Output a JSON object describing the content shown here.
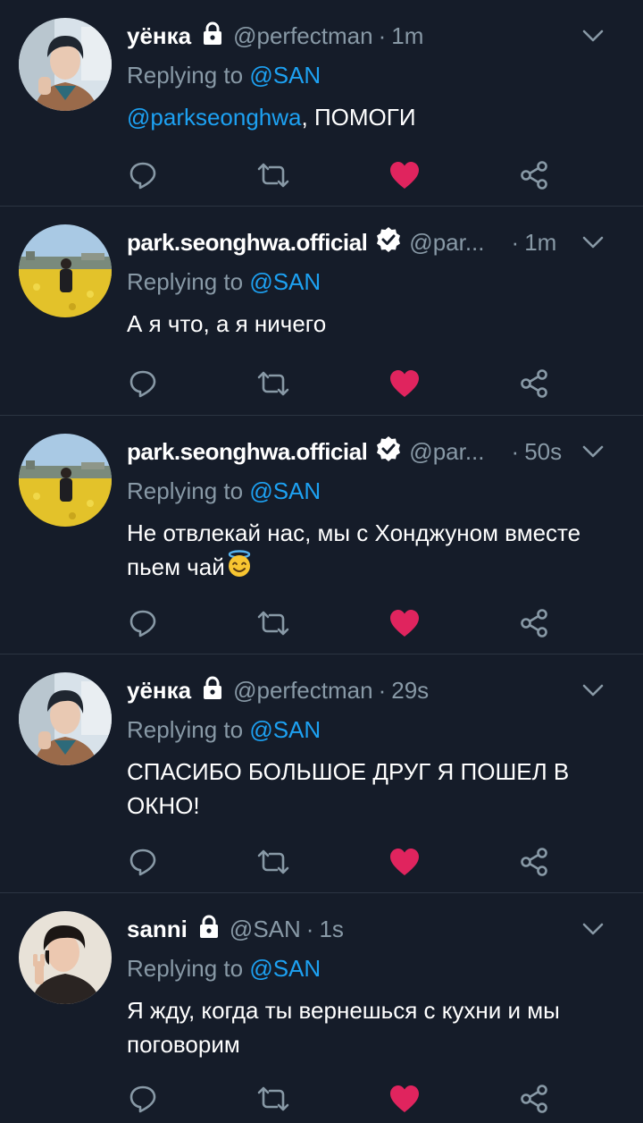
{
  "tweets": [
    {
      "name": "уёнка",
      "handle": "@perfectman",
      "time": "1m",
      "replying_prefix": "Replying to ",
      "replying_to": "@SAN",
      "mention": "@parkseonghwa",
      "text": ", ПОМОГИ",
      "liked": true,
      "protected": true
    },
    {
      "name": "park.seonghwa.official",
      "handle": "@par...",
      "time": "1m",
      "replying_prefix": "Replying to ",
      "replying_to": "@SAN",
      "text": "А я что, а я ничего",
      "liked": true,
      "verified": true
    },
    {
      "name": "park.seonghwa.official",
      "handle": "@par...",
      "time": "50s",
      "replying_prefix": "Replying to ",
      "replying_to": "@SAN",
      "text": "Не отвлекай нас, мы с Хонджуном вместе пьем чай",
      "emoji": "smiling-face-with-halo",
      "liked": true,
      "verified": true
    },
    {
      "name": "уёнка",
      "handle": "@perfectman",
      "time": "29s",
      "replying_prefix": "Replying to ",
      "replying_to": "@SAN",
      "text": "СПАСИБО БОЛЬШОЕ ДРУГ Я ПОШЕЛ В ОКНО!",
      "liked": true,
      "protected": true
    },
    {
      "name": "sanni",
      "handle": "@SAN",
      "time": "1s",
      "replying_prefix": "Replying to ",
      "replying_to": "@SAN",
      "text": "Я жду, когда ты вернешься с кухни и мы поговорим",
      "liked": true,
      "protected": true
    }
  ],
  "separator": "·",
  "colors": {
    "background": "#151c29",
    "muted": "#8899a6",
    "link": "#1da1f2",
    "like": "#e0245e",
    "divider": "#2b3442"
  },
  "icons": [
    "reply-icon",
    "retweet-icon",
    "heart-icon",
    "share-icon",
    "lock-icon",
    "verified-badge-icon",
    "chevron-down-icon"
  ]
}
